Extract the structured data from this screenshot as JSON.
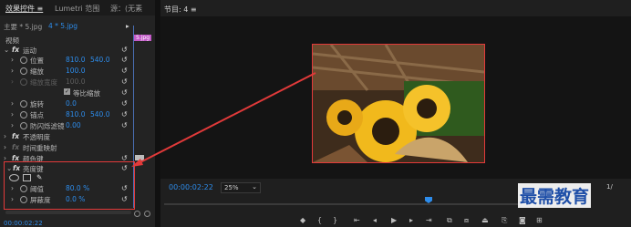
{
  "left_panel": {
    "tabs": [
      "效果控件 ≡",
      "Lumetri 范围",
      "源：(无素"
    ],
    "source_label": "主要 * 5.jpg",
    "clip_label": "4 * 5.jpg",
    "clip_marker": "5.jpg",
    "section_video": "视频",
    "effects": [
      {
        "name": "运动"
      },
      {
        "name": "位置",
        "v1": "810.0",
        "v2": "540.0"
      },
      {
        "name": "缩放",
        "v1": "100.0"
      },
      {
        "name": "缩放宽度",
        "v1": "100.0"
      },
      {
        "name": "等比缩放"
      },
      {
        "name": "旋转",
        "v1": "0.0"
      },
      {
        "name": "锚点",
        "v1": "810.0",
        "v2": "540.0"
      },
      {
        "name": "防闪烁滤镜",
        "v1": "0.00"
      },
      {
        "name": "不透明度"
      },
      {
        "name": "时间重映射"
      },
      {
        "name": "颜色键"
      },
      {
        "name": "亮度键"
      },
      {
        "name": "阈值",
        "v1": "80.0 %"
      },
      {
        "name": "屏蔽度",
        "v1": "0.0 %"
      }
    ],
    "timecode": "00:00:02:22"
  },
  "program_monitor": {
    "title": "节目: 4 ≡",
    "timecode": "00:00:02:22",
    "zoom": "25%",
    "page_indicator": "1/"
  },
  "watermark": "最需教育"
}
